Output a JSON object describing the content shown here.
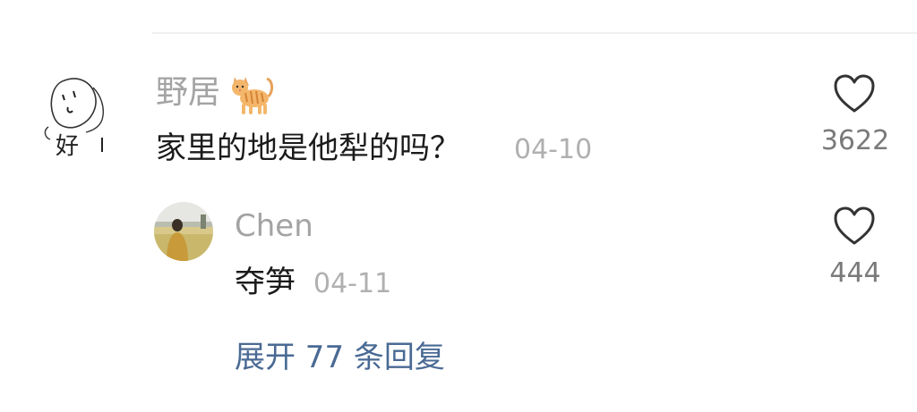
{
  "comment": {
    "username": "野居",
    "username_icon": "cat-emoji-icon",
    "text": "家里的地是他犁的吗？",
    "date": "04-10",
    "like_icon": "heart-outline-icon",
    "like_count": "3622"
  },
  "reply": {
    "username": "Chen",
    "text": "夺笋",
    "date": "04-11",
    "like_icon": "heart-outline-icon",
    "like_count": "444"
  },
  "expand_replies": {
    "label": "展开 77 条回复"
  },
  "colors": {
    "username": "#a3a3a3",
    "text": "#1b1b1b",
    "date": "#b0b0b0",
    "count": "#7a7a7a",
    "link": "#4a6a94",
    "divider": "#f0f0f0"
  }
}
